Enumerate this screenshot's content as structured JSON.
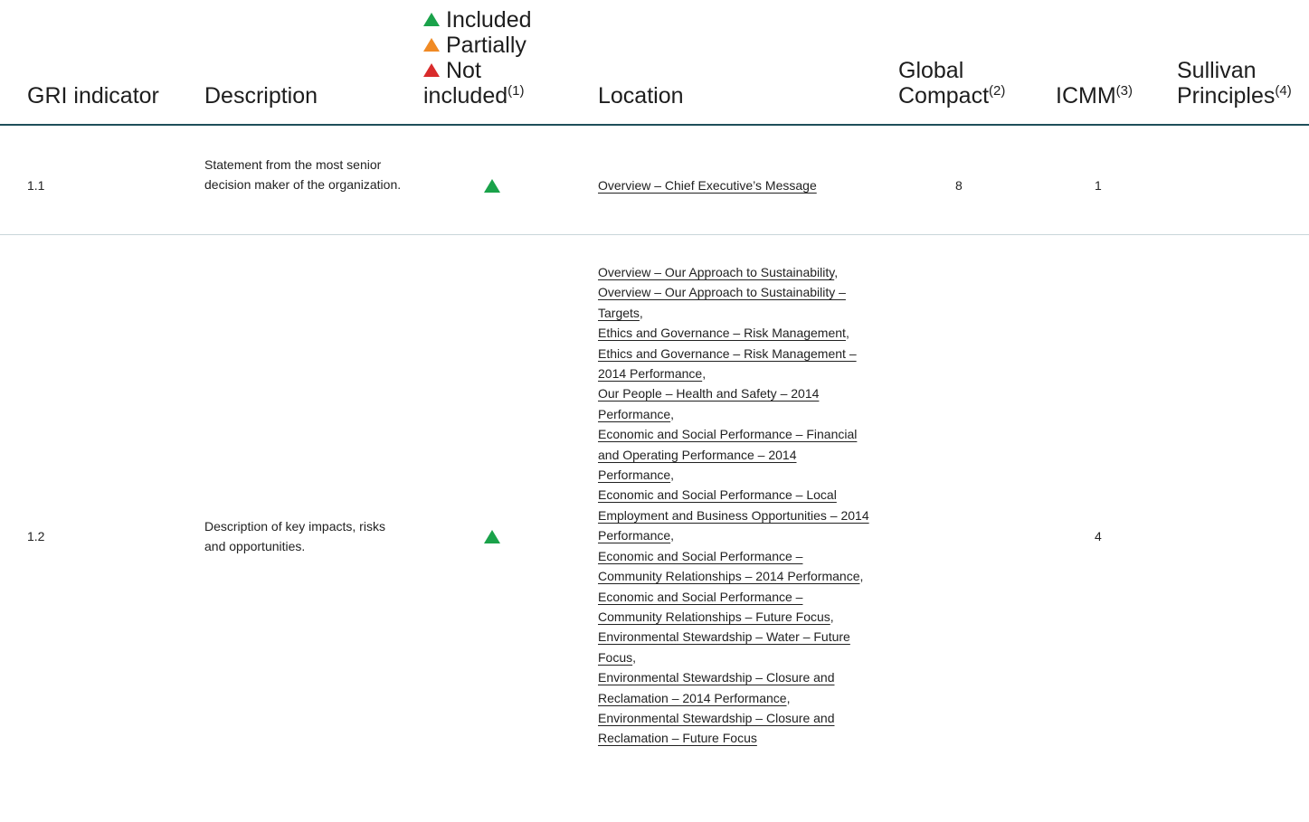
{
  "header": {
    "gri_indicator": "GRI indicator",
    "description": "Description",
    "legend": {
      "included": "Included",
      "partially": "Partially",
      "not_included": "Not included",
      "not_included_note": "(1)"
    },
    "location": "Location",
    "global_compact": "Global Compact",
    "global_compact_note": "(2)",
    "icmm": "ICMM",
    "icmm_note": "(3)",
    "sullivan": "Sullivan Principles",
    "sullivan_note": "(4)"
  },
  "colors": {
    "included": "#1aa24a",
    "partially": "#f08a24",
    "not_included": "#d92b2b",
    "rule": "#1f4f5a"
  },
  "rows": [
    {
      "indicator": "1.1",
      "description": "Statement from the most senior decision maker of the organization.",
      "status": "included",
      "location": [
        "Overview – Chief Executive’s Message"
      ],
      "global_compact": "8",
      "icmm": "1",
      "sullivan": ""
    },
    {
      "indicator": "1.2",
      "description": "Description of key impacts, risks and opportunities.",
      "status": "included",
      "location": [
        "Overview – Our Approach to Sustainability",
        "Overview – Our Approach to Sustainability – Targets",
        "Ethics and Governance – Risk Management",
        "Ethics and Governance – Risk Management – 2014 Performance",
        "Our People – Health and Safety – 2014 Performance",
        "Economic and Social Performance – Financial and Operating Performance – 2014 Performance",
        "Economic and Social Performance – Local Employment and Business Opportunities – 2014 Performance",
        "Economic and Social Performance – Community Relationships – 2014 Performance",
        "Economic and Social Performance – Community Relationships – Future Focus",
        "Environmental Stewardship – Water – Future Focus",
        "Environmental Stewardship – Closure and Reclamation – 2014 Performance",
        "Environmental Stewardship – Closure and Reclamation – Future Focus"
      ],
      "global_compact": "",
      "icmm": "4",
      "sullivan": ""
    }
  ]
}
